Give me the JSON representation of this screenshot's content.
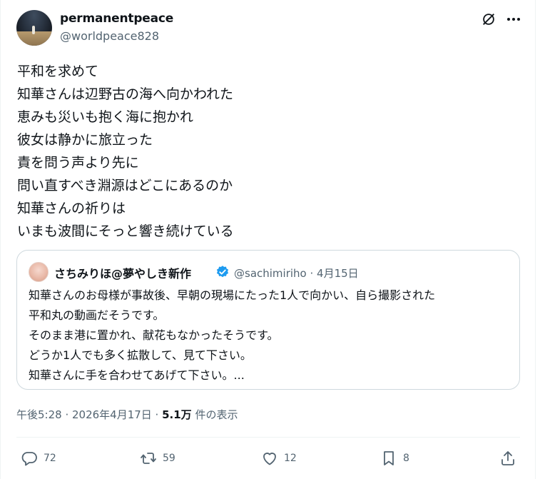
{
  "author": {
    "display_name": "permanentpeace",
    "handle": "@worldpeace828"
  },
  "tweet": {
    "lines": [
      "平和を求めて",
      "知華さんは辺野古の海へ向かわれた",
      "恵みも災いも抱く海に抱かれ",
      "彼女は静かに旅立った",
      "責を問う声より先に",
      "問い直すべき淵源はどこにあるのか",
      "知華さんの祈りは",
      "いまも波間にそっと響き続けている"
    ]
  },
  "quote": {
    "display_name": "さちみりほ@夢やしき新作",
    "meta": "@sachimiriho · 4月15日",
    "lines": [
      "知華さんのお母様が事故後、早朝の現場にたった1人で向かい、自ら撮影された",
      "平和丸の動画だそうです。",
      "そのまま港に置かれ、献花もなかったそうです。",
      "どうか1人でも多く拡散して、見て下さい。",
      "知華さんに手を合わせてあげて下さい。..."
    ]
  },
  "timestamp": {
    "time": "午後5:28 · 2026年4月17日 · ",
    "views_count": "5.1万",
    "views_label": " 件の表示"
  },
  "actions": {
    "replies": "72",
    "reposts": "59",
    "likes": "12",
    "bookmarks": "8"
  },
  "colors": {
    "text": "#0f1419",
    "secondary": "#536471",
    "border": "#cfd9de",
    "verified": "#1d9bf0"
  }
}
